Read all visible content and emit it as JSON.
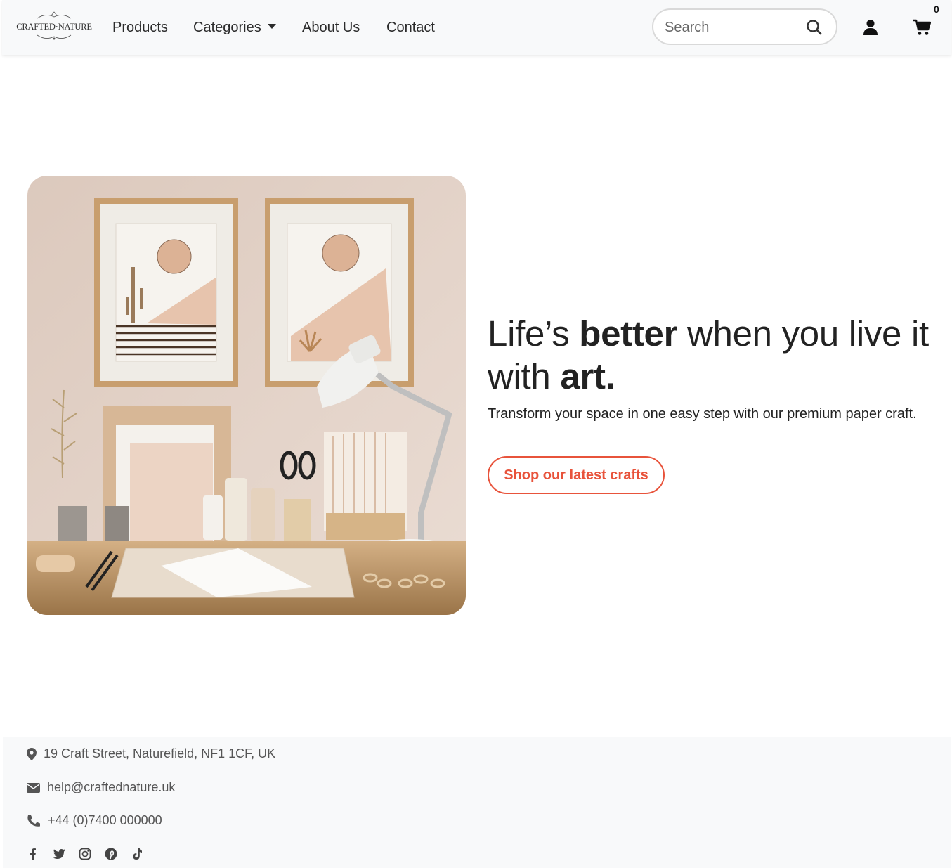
{
  "brand": {
    "logo_text": "CRAFTED·NATURE"
  },
  "nav": {
    "items": [
      {
        "label": "Products"
      },
      {
        "label": "Categories"
      },
      {
        "label": "About Us"
      },
      {
        "label": "Contact"
      }
    ]
  },
  "search": {
    "placeholder": "Search"
  },
  "cart": {
    "count": "0"
  },
  "hero": {
    "headline_part1": "Life’s ",
    "headline_bold1": "better",
    "headline_part2": " when you live it with ",
    "headline_bold2": "art.",
    "subtext": "Transform your space in one easy step with our premium paper craft.",
    "cta_label": "Shop our latest crafts"
  },
  "footer": {
    "address": "19 Craft Street, Naturefield, NF1 1CF, UK",
    "email": "help@craftednature.uk",
    "phone": "+44 (0)7400 000000",
    "social_icons": [
      "facebook-icon",
      "twitter-icon",
      "instagram-icon",
      "pinterest-icon",
      "tiktok-icon"
    ]
  },
  "colors": {
    "accent": "#e8533b",
    "navbar_bg": "#f8f9fa",
    "footer_bg": "#f8f9fa"
  }
}
